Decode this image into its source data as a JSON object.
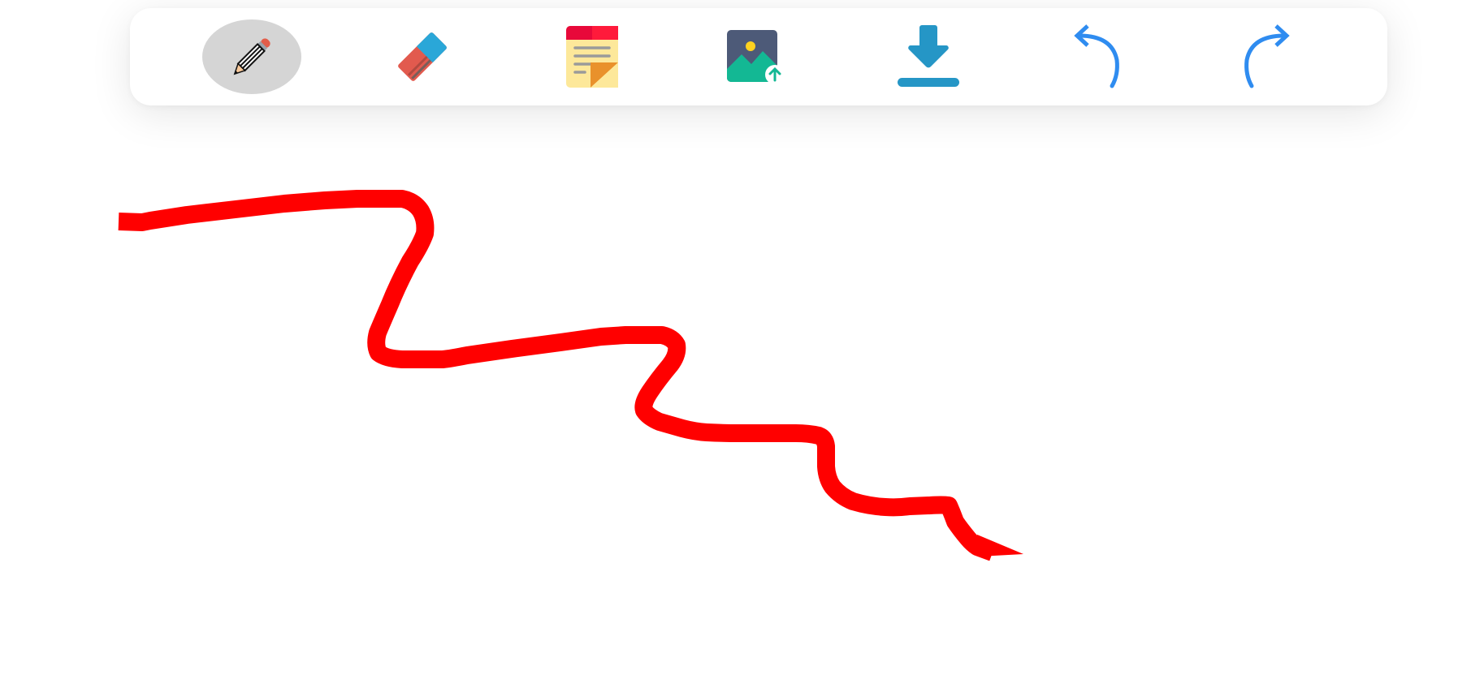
{
  "toolbar": {
    "tools": [
      {
        "id": "pencil",
        "icon": "pencil-icon",
        "active": true
      },
      {
        "id": "eraser",
        "icon": "eraser-icon",
        "active": false
      },
      {
        "id": "sticky-note",
        "icon": "sticky-note-icon",
        "active": false
      },
      {
        "id": "upload-image",
        "icon": "image-upload-icon",
        "active": false
      },
      {
        "id": "download",
        "icon": "download-icon",
        "active": false
      },
      {
        "id": "undo",
        "icon": "undo-icon",
        "active": false
      },
      {
        "id": "redo",
        "icon": "redo-icon",
        "active": false
      }
    ]
  },
  "canvas": {
    "stroke_color": "#ff0000",
    "background": "#ffffff"
  },
  "colors": {
    "active_tool_bg": "#d5d5d5",
    "accent_blue": "#2f8cf0",
    "download_blue": "#2596c6"
  }
}
